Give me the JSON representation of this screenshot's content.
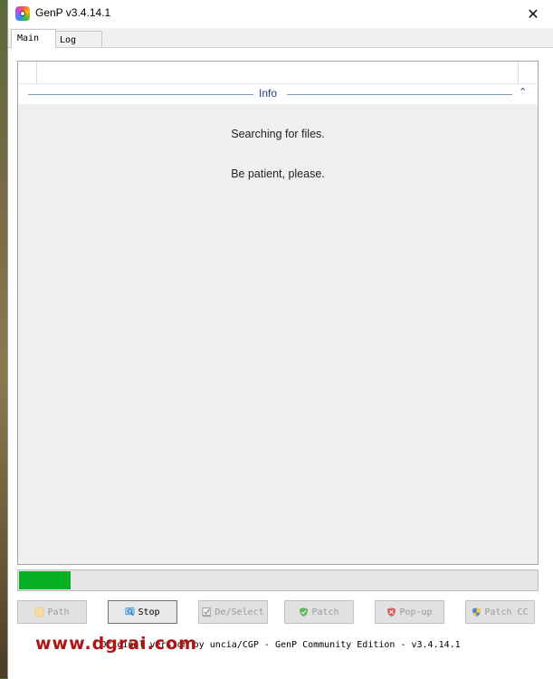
{
  "window": {
    "title": "GenP v3.4.14.1",
    "close_glyph": "✕"
  },
  "tabs": [
    {
      "label": "Main",
      "active": true
    },
    {
      "label": "Log",
      "active": false
    }
  ],
  "info": {
    "label": "Info",
    "collapse_glyph": "⌃",
    "messages": [
      "Searching for files.",
      "Be patient, please."
    ]
  },
  "progress": {
    "percent": 10,
    "color": "#06b025"
  },
  "buttons": [
    {
      "label": "Path",
      "icon": "folder-icon",
      "enabled": false
    },
    {
      "label": "Stop",
      "icon": "search-icon",
      "enabled": true
    },
    {
      "label": "De/Select",
      "icon": "checkbox-icon",
      "enabled": false
    },
    {
      "label": "Patch",
      "icon": "shield-check-icon",
      "enabled": false
    },
    {
      "label": "Pop-up",
      "icon": "shield-x-icon",
      "enabled": false
    },
    {
      "label": "Patch CC",
      "icon": "uac-shield-icon",
      "enabled": false
    }
  ],
  "footer": {
    "credit": "Original version by uncia/CGP - GenP Community Edition - v3.4.14.1"
  },
  "watermark": {
    "text": "www.dgrai.com"
  }
}
